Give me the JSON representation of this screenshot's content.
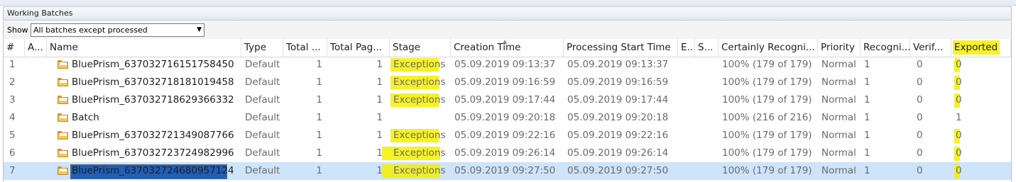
{
  "panel": {
    "title": "Working Batches"
  },
  "filter": {
    "label": "Show",
    "value": "All batches except processed"
  },
  "columns": [
    {
      "key": "num",
      "label": "#"
    },
    {
      "key": "a",
      "label": "A..."
    },
    {
      "key": "name",
      "label": "Name"
    },
    {
      "key": "type",
      "label": "Type"
    },
    {
      "key": "total",
      "label": "Total ..."
    },
    {
      "key": "pages",
      "label": "Total Pag..."
    },
    {
      "key": "stage",
      "label": "Stage"
    },
    {
      "key": "created",
      "label": "Creation Time"
    },
    {
      "key": "started",
      "label": "Processing Start Time"
    },
    {
      "key": "e",
      "label": "E..."
    },
    {
      "key": "s",
      "label": "S..."
    },
    {
      "key": "certain",
      "label": "Certainly Recogni..."
    },
    {
      "key": "priority",
      "label": "Priority"
    },
    {
      "key": "recog",
      "label": "Recogni..."
    },
    {
      "key": "verif",
      "label": "Verif..."
    },
    {
      "key": "exported",
      "label": "Exported"
    }
  ],
  "rows": [
    {
      "num": "1",
      "name": "BluePrism_637032716151758450",
      "type": "Default",
      "total": "1",
      "pages": "1",
      "stage": "Exceptions",
      "created": "05.09.2019 09:13:37",
      "started": "05.09.2019 09:13:37",
      "certain": "100% (179 of 179)",
      "priority": "Normal",
      "recog": "1",
      "verif": "0",
      "exported": "0"
    },
    {
      "num": "2",
      "name": "BluePrism_637032718181019458",
      "type": "Default",
      "total": "1",
      "pages": "1",
      "stage": "Exceptions",
      "created": "05.09.2019 09:16:59",
      "started": "05.09.2019 09:16:59",
      "certain": "100% (179 of 179)",
      "priority": "Normal",
      "recog": "1",
      "verif": "0",
      "exported": "0"
    },
    {
      "num": "3",
      "name": "BluePrism_637032718629366332",
      "type": "Default",
      "total": "1",
      "pages": "1",
      "stage": "Exceptions",
      "created": "05.09.2019 09:17:44",
      "started": "05.09.2019 09:17:44",
      "certain": "100% (179 of 179)",
      "priority": "Normal",
      "recog": "1",
      "verif": "0",
      "exported": "0"
    },
    {
      "num": "4",
      "name": "Batch",
      "type": "Default",
      "total": "1",
      "pages": "1",
      "stage": "",
      "created": "05.09.2019 09:20:18",
      "started": "05.09.2019 09:20:18",
      "certain": "100% (216 of 216)",
      "priority": "Normal",
      "recog": "1",
      "verif": "0",
      "exported": "1"
    },
    {
      "num": "5",
      "name": "BluePrism_637032721349087766",
      "type": "Default",
      "total": "1",
      "pages": "1",
      "stage": "Exceptions",
      "created": "05.09.2019 09:22:16",
      "started": "05.09.2019 09:22:16",
      "certain": "100% (179 of 179)",
      "priority": "Normal",
      "recog": "1",
      "verif": "0",
      "exported": "0"
    },
    {
      "num": "6",
      "name": "BluePrism_637032723724982996",
      "type": "Default",
      "total": "1",
      "pages": "1",
      "stage": "Exceptions",
      "created": "05.09.2019 09:26:14",
      "started": "05.09.2019 09:26:14",
      "certain": "100% (179 of 179)",
      "priority": "Normal",
      "recog": "1",
      "verif": "0",
      "exported": "0"
    },
    {
      "num": "7",
      "name": "BluePrism_637032724680957124",
      "type": "Default",
      "total": "1",
      "pages": "1",
      "stage": "Exceptions",
      "created": "05.09.2019 09:27:50",
      "started": "05.09.2019 09:27:50",
      "certain": "100% (179 of 179)",
      "priority": "Normal",
      "recog": "1",
      "verif": "0",
      "exported": "0",
      "selected": true
    }
  ],
  "colors": {
    "highlight": "#f4f000",
    "selection": "#cde4fb",
    "name_selection": "#1f5fb8"
  },
  "icons": {
    "batch": "folder-icon",
    "dropdown": "chevron-down-icon",
    "sort": "sort-ascending-icon"
  }
}
